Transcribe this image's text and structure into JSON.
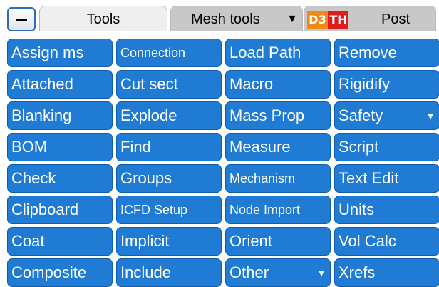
{
  "tabs": {
    "tools_label": "Tools",
    "mesh_tools_label": "Mesh tools",
    "mesh_tools_caret": "▼",
    "post_label": "Post",
    "post_logo_d3": "D3",
    "post_logo_th": "TH"
  },
  "colors": {
    "button_blue": "#1f7bd3",
    "d3_orange": "#f08a16",
    "th_red": "#e01b1b",
    "active_tab": "#efefef",
    "inactive_tab": "#c8c8c8"
  },
  "grid": {
    "columns": [
      [
        {
          "label": "Assign ms",
          "small": false
        },
        {
          "label": "Attached",
          "small": false
        },
        {
          "label": "Blanking",
          "small": false
        },
        {
          "label": "BOM",
          "small": false
        },
        {
          "label": "Check",
          "small": false
        },
        {
          "label": "Clipboard",
          "small": false
        },
        {
          "label": "Coat",
          "small": false
        },
        {
          "label": "Composite",
          "small": false
        }
      ],
      [
        {
          "label": "Connection",
          "small": true
        },
        {
          "label": "Cut sect",
          "small": false
        },
        {
          "label": "Explode",
          "small": false
        },
        {
          "label": "Find",
          "small": false
        },
        {
          "label": "Groups",
          "small": false
        },
        {
          "label": "ICFD Setup",
          "small": true
        },
        {
          "label": "Implicit",
          "small": false
        },
        {
          "label": "Include",
          "small": false
        }
      ],
      [
        {
          "label": "Load Path",
          "small": false
        },
        {
          "label": "Macro",
          "small": false
        },
        {
          "label": "Mass Prop",
          "small": false
        },
        {
          "label": "Measure",
          "small": false
        },
        {
          "label": "Mechanism",
          "small": true
        },
        {
          "label": "Node Import",
          "small": true
        },
        {
          "label": "Orient",
          "small": false
        },
        {
          "label": "Other",
          "small": false,
          "caret": "▼"
        }
      ],
      [
        {
          "label": "Remove",
          "small": false
        },
        {
          "label": "Rigidify",
          "small": false
        },
        {
          "label": "Safety",
          "small": false,
          "caret": "▼"
        },
        {
          "label": "Script",
          "small": false
        },
        {
          "label": "Text Edit",
          "small": false
        },
        {
          "label": "Units",
          "small": false
        },
        {
          "label": "Vol Calc",
          "small": false
        },
        {
          "label": "Xrefs",
          "small": false
        }
      ]
    ]
  }
}
